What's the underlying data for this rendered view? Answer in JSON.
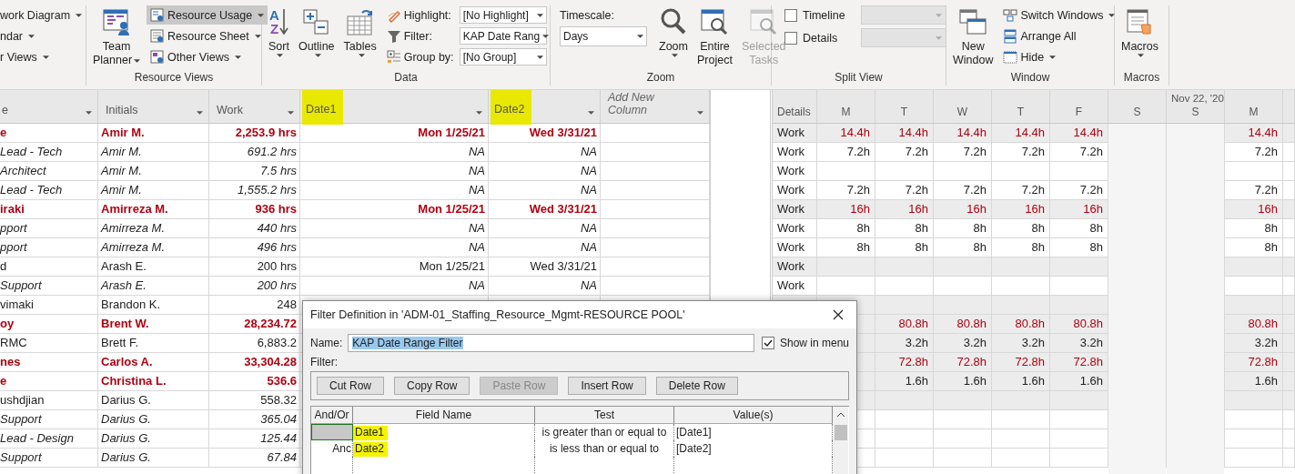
{
  "ribbon": {
    "view_list": [
      {
        "label": "work Diagram"
      },
      {
        "label": "ndar"
      },
      {
        "label": "r Views"
      }
    ],
    "resource_views": {
      "title": "Resource Views",
      "big_lines": [
        "Team",
        "Planner"
      ],
      "items": [
        {
          "kind": "usage",
          "label": "Resource Usage",
          "selected": true
        },
        {
          "kind": "sheet",
          "label": "Resource Sheet",
          "selected": false
        },
        {
          "kind": "other",
          "label": "Other Views",
          "selected": false
        }
      ]
    },
    "data": {
      "title": "Data",
      "buttons": [
        {
          "kind": "sort",
          "label": "Sort",
          "icon_letters": [
            "A",
            "Z"
          ]
        },
        {
          "kind": "outline",
          "label": "Outline"
        },
        {
          "kind": "tables",
          "label": "Tables"
        }
      ],
      "fields": [
        {
          "kind": "highlight",
          "label": "Highlight:",
          "value": "[No Highlight]"
        },
        {
          "kind": "filter",
          "label": "Filter:",
          "value": "KAP Date Rang"
        },
        {
          "kind": "group",
          "label": "Group by:",
          "value": "[No Group]"
        }
      ]
    },
    "zoom": {
      "title": "Zoom",
      "timescale_label": "Timescale:",
      "timescale": "Days",
      "buttons": [
        {
          "kind": "zoom",
          "lines": [
            "Zoom"
          ],
          "disabled": false
        },
        {
          "kind": "entire",
          "lines": [
            "Entire",
            "Project"
          ],
          "disabled": false
        },
        {
          "kind": "selected",
          "lines": [
            "Selected",
            "Tasks"
          ],
          "disabled": true
        }
      ]
    },
    "split_view": {
      "title": "Split View",
      "options": [
        {
          "label": "Timeline",
          "checked": false
        },
        {
          "label": "Details",
          "checked": false
        }
      ]
    },
    "window": {
      "title": "Window",
      "new_window": [
        "New",
        "Window"
      ],
      "items": [
        {
          "kind": "switch",
          "label": "Switch Windows"
        },
        {
          "kind": "arrange",
          "label": "Arrange All"
        },
        {
          "kind": "hide",
          "label": "Hide"
        }
      ]
    },
    "macros": {
      "title": "Macros",
      "label": "Macros"
    }
  },
  "table": {
    "columns": [
      {
        "label": "e",
        "highlighted": false
      },
      {
        "label": "Initials",
        "highlighted": false
      },
      {
        "label": "Work",
        "highlighted": false
      },
      {
        "label": "Date1",
        "highlighted": true
      },
      {
        "label": "Date2",
        "highlighted": true
      },
      {
        "label": "Add New Column",
        "highlighted": false
      }
    ],
    "rows": [
      {
        "kind": "resource",
        "overallocated": true,
        "cells": [
          "e",
          "Amir M.",
          "2,253.9 hrs",
          "Mon 1/25/21",
          "Wed 3/31/21"
        ],
        "details": "Work",
        "work_overallocated": true,
        "work_days": [
          "14.4h",
          "14.4h",
          "14.4h",
          "14.4h",
          "14.4h",
          "14.4h"
        ]
      },
      {
        "kind": "assignment",
        "overallocated": false,
        "cells": [
          "Lead - Tech",
          "Amir M.",
          "691.2 hrs",
          "NA",
          "NA"
        ],
        "details": "Work",
        "work_overallocated": false,
        "work_days": [
          "7.2h",
          "7.2h",
          "7.2h",
          "7.2h",
          "7.2h",
          "7.2h"
        ]
      },
      {
        "kind": "assignment",
        "overallocated": false,
        "cells": [
          "Architect",
          "Amir M.",
          "7.5 hrs",
          "NA",
          "NA"
        ],
        "details": "Work"
      },
      {
        "kind": "assignment",
        "overallocated": false,
        "cells": [
          "Lead - Tech",
          "Amir M.",
          "1,555.2 hrs",
          "NA",
          "NA"
        ],
        "details": "Work",
        "work_overallocated": false,
        "work_days": [
          "7.2h",
          "7.2h",
          "7.2h",
          "7.2h",
          "7.2h",
          "7.2h"
        ]
      },
      {
        "kind": "resource",
        "overallocated": true,
        "cells": [
          "iraki",
          "Amirreza M.",
          "936 hrs",
          "Mon 1/25/21",
          "Wed 3/31/21"
        ],
        "details": "Work",
        "work_overallocated": true,
        "work_days": [
          "16h",
          "16h",
          "16h",
          "16h",
          "16h",
          "16h"
        ]
      },
      {
        "kind": "assignment",
        "overallocated": false,
        "cells": [
          "pport",
          "Amirreza M.",
          "440 hrs",
          "NA",
          "NA"
        ],
        "details": "Work",
        "work_overallocated": false,
        "work_days": [
          "8h",
          "8h",
          "8h",
          "8h",
          "8h",
          "8h"
        ]
      },
      {
        "kind": "assignment",
        "overallocated": false,
        "cells": [
          "pport",
          "Amirreza M.",
          "496 hrs",
          "NA",
          "NA"
        ],
        "details": "Work",
        "work_overallocated": false,
        "work_days": [
          "8h",
          "8h",
          "8h",
          "8h",
          "8h",
          "8h"
        ]
      },
      {
        "kind": "resource",
        "overallocated": false,
        "cells": [
          "d",
          "Arash E.",
          "200 hrs",
          "Mon 1/25/21",
          "Wed 3/31/21"
        ],
        "details": "Work"
      },
      {
        "kind": "assignment",
        "overallocated": false,
        "cells": [
          "Support",
          "Arash E.",
          "200 hrs",
          "NA",
          "NA"
        ],
        "details": "Work"
      },
      {
        "kind": "resource",
        "overallocated": false,
        "cells": [
          "vimaki",
          "Brandon K.",
          "248"
        ]
      },
      {
        "kind": "resource",
        "overallocated": true,
        "cells": [
          "oy",
          "Brent W.",
          "28,234.72"
        ],
        "work_overallocated": true,
        "work_days_after_dialog": [
          "80.8h",
          "80.8h",
          "80.8h",
          "80.8h",
          "80.8h"
        ]
      },
      {
        "kind": "resource",
        "overallocated": false,
        "cells": [
          "RMC",
          "Brett F.",
          "6,883.2"
        ],
        "work_overallocated": false,
        "work_days_after_dialog": [
          "3.2h",
          "3.2h",
          "3.2h",
          "3.2h",
          "3.2h"
        ]
      },
      {
        "kind": "resource",
        "overallocated": true,
        "cells": [
          "nes",
          "Carlos A.",
          "33,304.28"
        ],
        "work_overallocated": true,
        "work_days_after_dialog": [
          "72.8h",
          "72.8h",
          "72.8h",
          "72.8h",
          "72.8h"
        ]
      },
      {
        "kind": "resource",
        "overallocated": true,
        "cells": [
          "e",
          "Christina L.",
          "536.6"
        ],
        "work_overallocated": false,
        "work_days_after_dialog": [
          "1.6h",
          "1.6h",
          "1.6h",
          "1.6h",
          "1.6h"
        ]
      },
      {
        "kind": "resource",
        "overallocated": false,
        "cells": [
          "ushdjian",
          "Darius G.",
          "558.32"
        ]
      },
      {
        "kind": "assignment",
        "overallocated": false,
        "cells": [
          "Support",
          "Darius G.",
          "365.04"
        ]
      },
      {
        "kind": "assignment",
        "overallocated": false,
        "cells": [
          "Lead - Design",
          "Darius G.",
          "125.44"
        ]
      },
      {
        "kind": "assignment",
        "overallocated": false,
        "cells": [
          "Support",
          "Darius G.",
          "67.84"
        ]
      }
    ]
  },
  "usage": {
    "details_heading": "Details",
    "days": [
      {
        "label": "M",
        "weekend": false
      },
      {
        "label": "T",
        "weekend": false
      },
      {
        "label": "W",
        "weekend": false
      },
      {
        "label": "T",
        "weekend": false
      },
      {
        "label": "F",
        "weekend": false
      },
      {
        "label": "S",
        "weekend": true
      },
      {
        "label": "S",
        "weekend": true,
        "week_label": "Nov 22, '20"
      },
      {
        "label": "M",
        "weekend": false
      }
    ]
  },
  "dialog": {
    "title": "Filter Definition in 'ADM-01_Staffing_Resource_Mgmt-RESOURCE POOL'",
    "name_label": "Name:",
    "name_value": "KAP Date Range Filter",
    "show_in_menu": {
      "label": "Show in menu",
      "checked": true
    },
    "filter_label": "Filter:",
    "buttons": [
      {
        "label": "Cut Row",
        "disabled": false
      },
      {
        "label": "Copy Row",
        "disabled": false
      },
      {
        "label": "Paste Row",
        "disabled": true
      },
      {
        "label": "Insert Row",
        "disabled": false
      },
      {
        "label": "Delete Row",
        "disabled": false
      }
    ],
    "columns": [
      "And/Or",
      "Field Name",
      "Test",
      "Value(s)"
    ],
    "rows": [
      {
        "field": "Date1",
        "test": "is greater than or equal to",
        "value": "[Date1]",
        "selected": true,
        "highlighted": true
      },
      {
        "and_or": "Anc",
        "field": "Date2",
        "test": "is less than or equal to",
        "value": "[Date2]",
        "selected": false,
        "highlighted": true
      }
    ]
  }
}
